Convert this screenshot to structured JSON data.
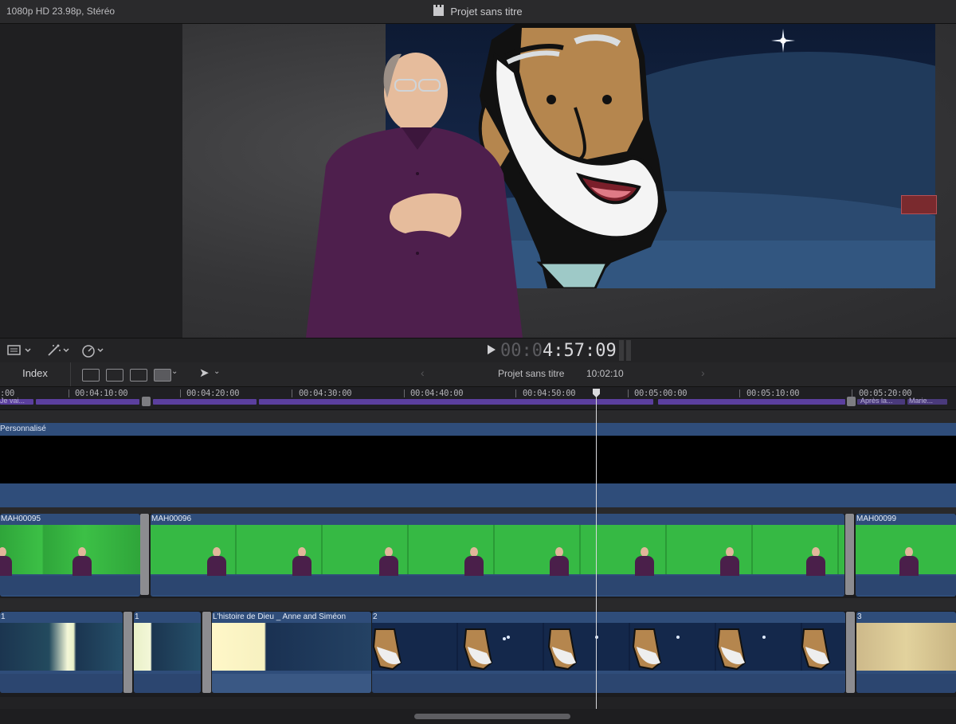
{
  "top_bar": {
    "format": "1080p HD 23.98p, Stéréo",
    "project_title": "Projet sans titre"
  },
  "viewer": {
    "timecode_dim": "00:0",
    "timecode_lit": "4:57:09"
  },
  "timeline_header": {
    "index_label": "Index",
    "project_name": "Projet sans titre",
    "duration": "10:02:10"
  },
  "ruler": {
    "ticks": [
      ":00",
      "00:04:10:00",
      "00:04:20:00",
      "00:04:30:00",
      "00:04:40:00",
      "00:04:50:00",
      "00:05:00:00",
      "00:05:10:00",
      "00:05:20:00"
    ],
    "markers_left": "Je vai...",
    "markers_right_1": "Après la...",
    "markers_right_2": "Marie..."
  },
  "tracks": {
    "storyline_label": "Personnalisé",
    "video_clips": [
      "MAH00095",
      "MAH00096",
      "MAH00099"
    ],
    "anim_clips": [
      "1",
      "1",
      "L'histoire de Dieu _ Anne and Siméon",
      "2",
      "3"
    ]
  },
  "colors": {
    "clip_blue": "#2f4d7a",
    "green_screen": "#2fb43a",
    "marker_purple": "#5b3f9e"
  }
}
